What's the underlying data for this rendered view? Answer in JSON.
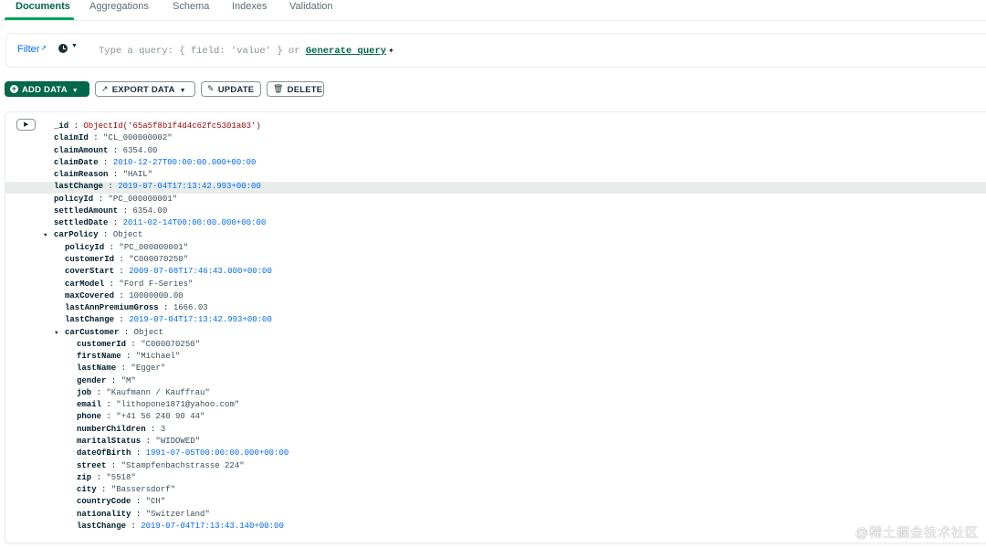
{
  "tabs": [
    {
      "label": "Documents",
      "active": true
    },
    {
      "label": "Aggregations",
      "active": false
    },
    {
      "label": "Schema",
      "active": false
    },
    {
      "label": "Indexes",
      "active": false
    },
    {
      "label": "Validation",
      "active": false
    }
  ],
  "filter": {
    "label": "Filter",
    "placeholder_prefix": "Type a query: { field: 'value' } or ",
    "generate_link": "Generate query",
    "sparkle_icon": "sparkle-icon"
  },
  "toolbar": {
    "add_data": "ADD DATA",
    "export_data": "EXPORT DATA",
    "update": "UPDATE",
    "delete": "DELETE"
  },
  "document": {
    "id_key": "_id",
    "id_value": "ObjectId('65a5f8b1f4d4c62fc5301a03')",
    "top_fields": [
      {
        "key": "claimId",
        "value": "\"CL_000000002\"",
        "type": "str"
      },
      {
        "key": "claimAmount",
        "value": "6354.00",
        "type": "num"
      },
      {
        "key": "claimDate",
        "value": "2010-12-27T00:00:00.000+00:00",
        "type": "date"
      },
      {
        "key": "claimReason",
        "value": "\"HAIL\"",
        "type": "str"
      },
      {
        "key": "lastChange",
        "value": "2019-07-04T17:13:42.993+00:00",
        "type": "date"
      },
      {
        "key": "policyId",
        "value": "\"PC_000000001\"",
        "type": "str"
      },
      {
        "key": "settledAmount",
        "value": "6354.00",
        "type": "num"
      },
      {
        "key": "settledDate",
        "value": "2011-02-14T00:00:00.000+00:00",
        "type": "date"
      }
    ],
    "carPolicy": {
      "key": "carPolicy",
      "type_label": "Object",
      "fields": [
        {
          "key": "policyId",
          "value": "\"PC_000000001\"",
          "type": "str"
        },
        {
          "key": "customerId",
          "value": "\"C000070250\"",
          "type": "str"
        },
        {
          "key": "coverStart",
          "value": "2009-07-08T17:46:43.000+00:00",
          "type": "date"
        },
        {
          "key": "carModel",
          "value": "\"Ford F-Series\"",
          "type": "str"
        },
        {
          "key": "maxCovered",
          "value": "10000000.00",
          "type": "num"
        },
        {
          "key": "lastAnnPremiumGross",
          "value": "1666.03",
          "type": "num"
        },
        {
          "key": "lastChange",
          "value": "2019-07-04T17:13:42.993+00:00",
          "type": "date"
        }
      ]
    },
    "carCustomer": {
      "key": "carCustomer",
      "type_label": "Object",
      "fields": [
        {
          "key": "customerId",
          "value": "\"C000070250\"",
          "type": "str"
        },
        {
          "key": "firstName",
          "value": "\"Michael\"",
          "type": "str"
        },
        {
          "key": "lastName",
          "value": "\"Egger\"",
          "type": "str"
        },
        {
          "key": "gender",
          "value": "\"M\"",
          "type": "str"
        },
        {
          "key": "job",
          "value": "\"Kaufmann / Kauffrau\"",
          "type": "str"
        },
        {
          "key": "email",
          "value": "\"lithopone1871@yahoo.com\"",
          "type": "str"
        },
        {
          "key": "phone",
          "value": "\"+41 56 240 90 44\"",
          "type": "str"
        },
        {
          "key": "numberChildren",
          "value": "3",
          "type": "num"
        },
        {
          "key": "maritalStatus",
          "value": "\"WIDOWED\"",
          "type": "str"
        },
        {
          "key": "dateOfBirth",
          "value": "1991-07-05T00:00:00.000+00:00",
          "type": "date"
        },
        {
          "key": "street",
          "value": "\"Stampfenbachstrasse 224\"",
          "type": "str"
        },
        {
          "key": "zip",
          "value": "\"5518\"",
          "type": "str"
        },
        {
          "key": "city",
          "value": "\"Bassersdorf\"",
          "type": "str"
        },
        {
          "key": "countryCode",
          "value": "\"CH\"",
          "type": "str"
        },
        {
          "key": "nationality",
          "value": "\"Switzerland\"",
          "type": "str"
        },
        {
          "key": "lastChange",
          "value": "2019-07-04T17:13:43.140+00:00",
          "type": "date"
        }
      ]
    }
  },
  "watermark": "@稀土掘金技术社区"
}
